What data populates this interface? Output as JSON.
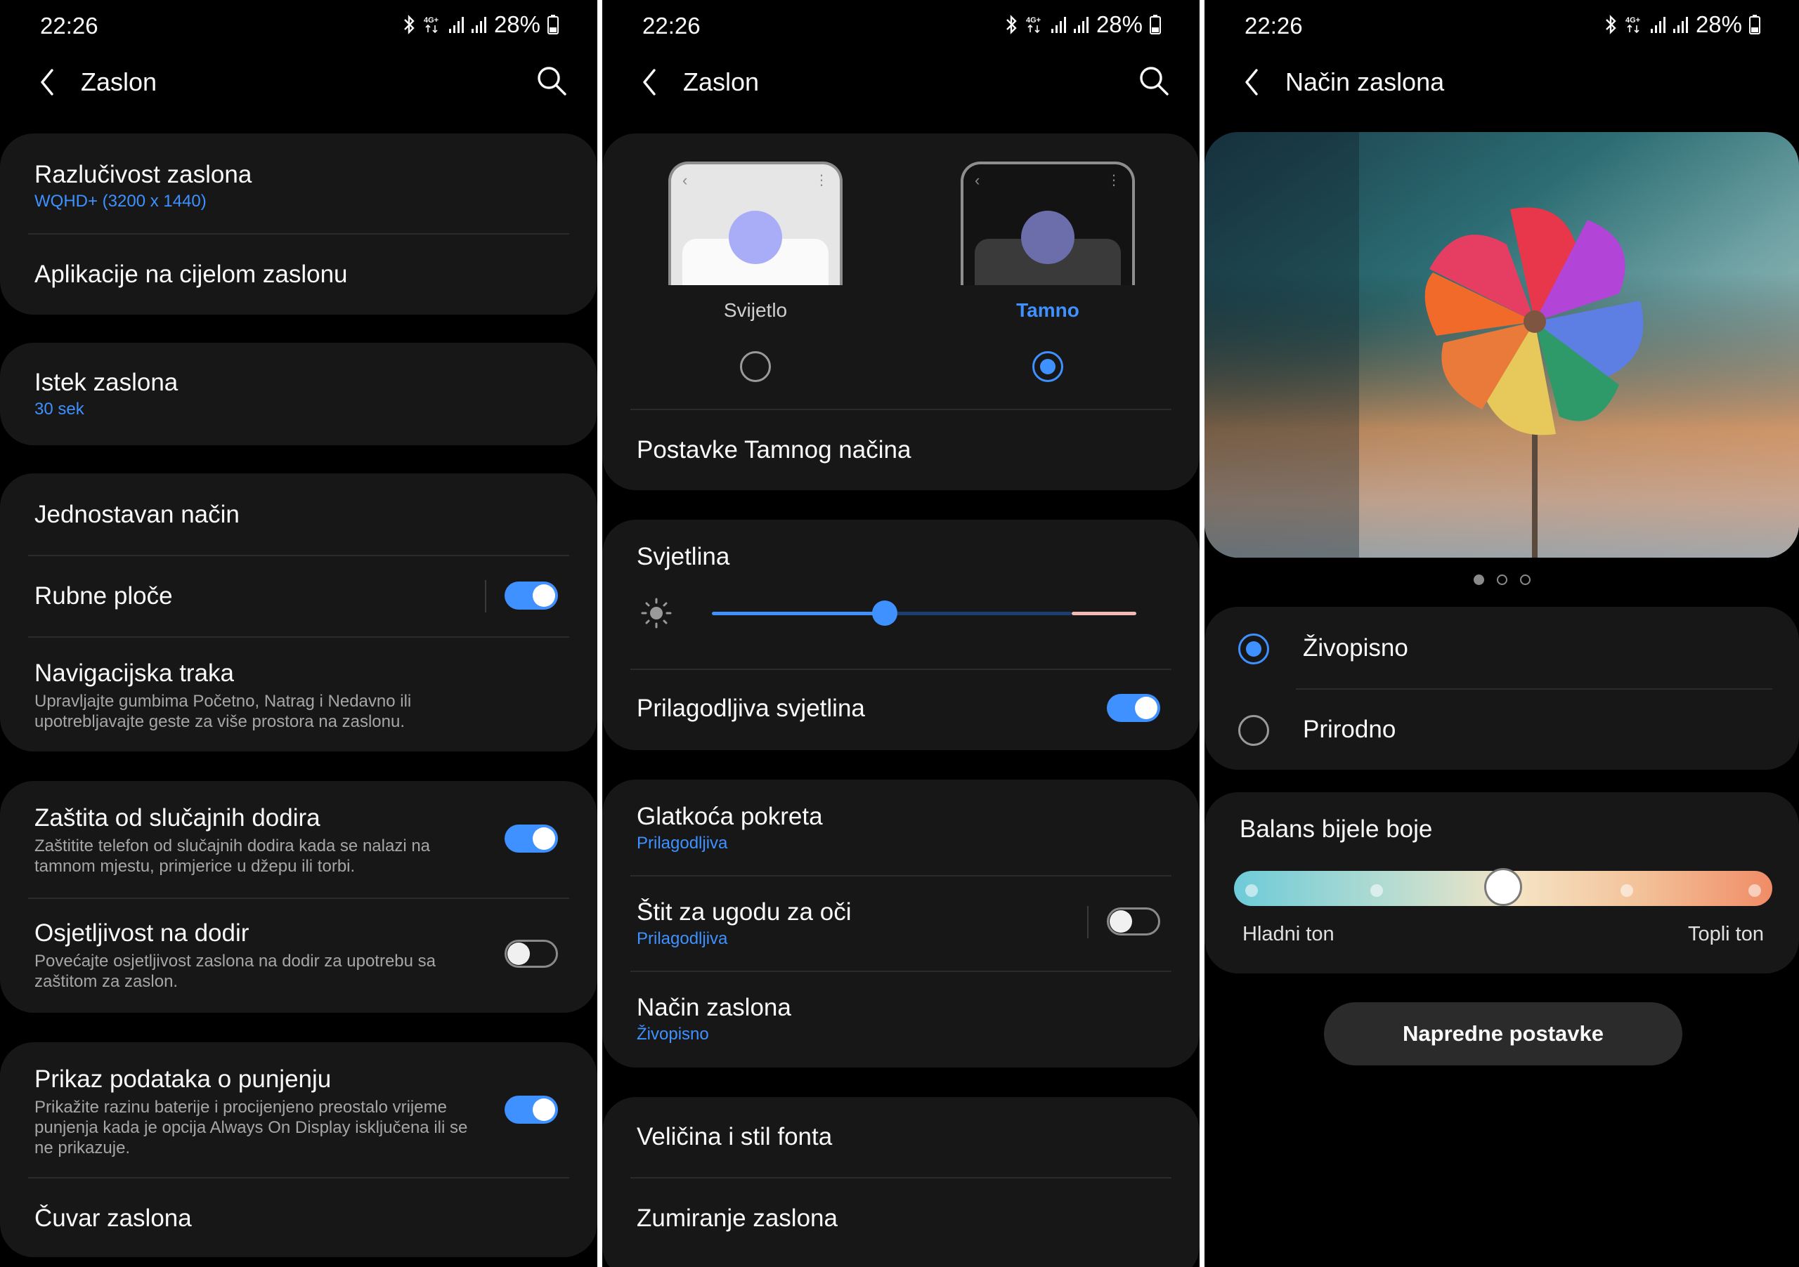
{
  "status_bar": {
    "time": "22:26",
    "battery": "28%",
    "network": "4G+"
  },
  "screen1": {
    "title": "Zaslon",
    "items": [
      {
        "title": "Razlučivost zaslona",
        "sub": "WQHD+ (3200 x 1440)"
      },
      {
        "title": "Aplikacije na cijelom zaslonu"
      },
      {
        "title": "Istek zaslona",
        "sub": "30 sek"
      },
      {
        "title": "Jednostavan način"
      },
      {
        "title": "Rubne ploče",
        "toggle": true
      },
      {
        "title": "Navigacijska traka",
        "desc": "Upravljajte gumbima Početno, Natrag i Nedavno ili upotrebljavajte geste za više prostora na zaslonu."
      },
      {
        "title": "Zaštita od slučajnih dodira",
        "desc": "Zaštitite telefon od slučajnih dodira kada se nalazi na tamnom mjestu, primjerice u džepu ili torbi.",
        "toggle": true
      },
      {
        "title": "Osjetljivost na dodir",
        "desc": "Povećajte osjetljivost zaslona na dodir za upotrebu sa zaštitom za zaslon.",
        "toggle": false
      },
      {
        "title": "Prikaz podataka o punjenju",
        "desc": "Prikažite razinu baterije i procijenjeno preostalo vrijeme punjenja kada je opcija Always On Display isključena ili se ne prikazuje.",
        "toggle": true
      },
      {
        "title": "Čuvar zaslona"
      }
    ]
  },
  "screen2": {
    "title": "Zaslon",
    "theme": {
      "light_label": "Svijetlo",
      "dark_label": "Tamno",
      "selected": "dark"
    },
    "dark_settings": "Postavke Tamnog načina",
    "brightness": {
      "label": "Svjetlina",
      "level": 0.48
    },
    "adaptive_brightness": {
      "label": "Prilagodljiva svjetlina",
      "toggle": true
    },
    "items": [
      {
        "title": "Glatkoća pokreta",
        "sub": "Prilagodljiva"
      },
      {
        "title": "Štit za ugodu za oči",
        "sub": "Prilagodljiva",
        "toggle": false
      },
      {
        "title": "Način zaslona",
        "sub": "Živopisno"
      },
      {
        "title": "Veličina i stil fonta"
      },
      {
        "title": "Zumiranje zaslona"
      }
    ]
  },
  "screen3": {
    "title": "Način zaslona",
    "page_dots": {
      "count": 3,
      "active": 1
    },
    "modes": [
      {
        "label": "Živopisno",
        "checked": true
      },
      {
        "label": "Prirodno",
        "checked": false
      }
    ],
    "white_balance": {
      "label": "Balans bijele boje",
      "cool_label": "Hladni ton",
      "warm_label": "Topli ton",
      "level": 0.5
    },
    "advanced_button": "Napredne postavke"
  },
  "colors": {
    "accent": "#3e91ff",
    "card": "#171717",
    "background": "#000000"
  },
  "icons": [
    "back-icon",
    "search-icon",
    "bluetooth-icon",
    "signal-icon",
    "battery-icon",
    "sun-icon"
  ]
}
